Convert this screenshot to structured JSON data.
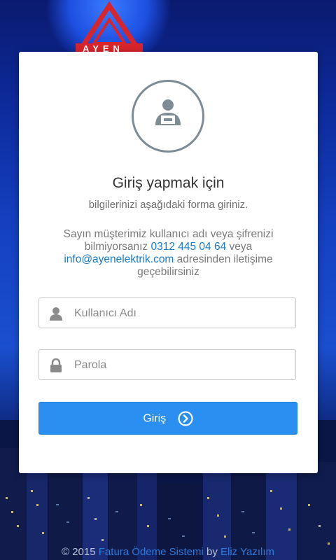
{
  "brand": {
    "logo_text": "AYEN",
    "color": "#d8242b"
  },
  "login": {
    "title": "Giriş yapmak için",
    "subtitle": "bilgilerinizi aşağıdaki forma giriniz.",
    "notice": {
      "text_before": "Sayın müşterimiz kullanıcı adı veya şifrenizi bilmiyorsanız ",
      "phone": "0312 445 04 64",
      "text_middle": " veya ",
      "email": "info@ayenelektrik.com",
      "text_after": " adresinden iletişime geçebilirsiniz"
    },
    "username": {
      "placeholder": "Kullanıcı Adı",
      "value": "",
      "icon": "user-icon"
    },
    "password": {
      "placeholder": "Parola",
      "value": "",
      "icon": "lock-icon"
    },
    "submit": {
      "label": "Giriş",
      "icon": "chevron-circle-right-icon",
      "color": "#2a8ff0"
    }
  },
  "footer": {
    "copyright": "© 2015 ",
    "system_link": "Fatura Ödeme Sistemi",
    "by": " by ",
    "author_link": "Eliz Yazılım"
  }
}
